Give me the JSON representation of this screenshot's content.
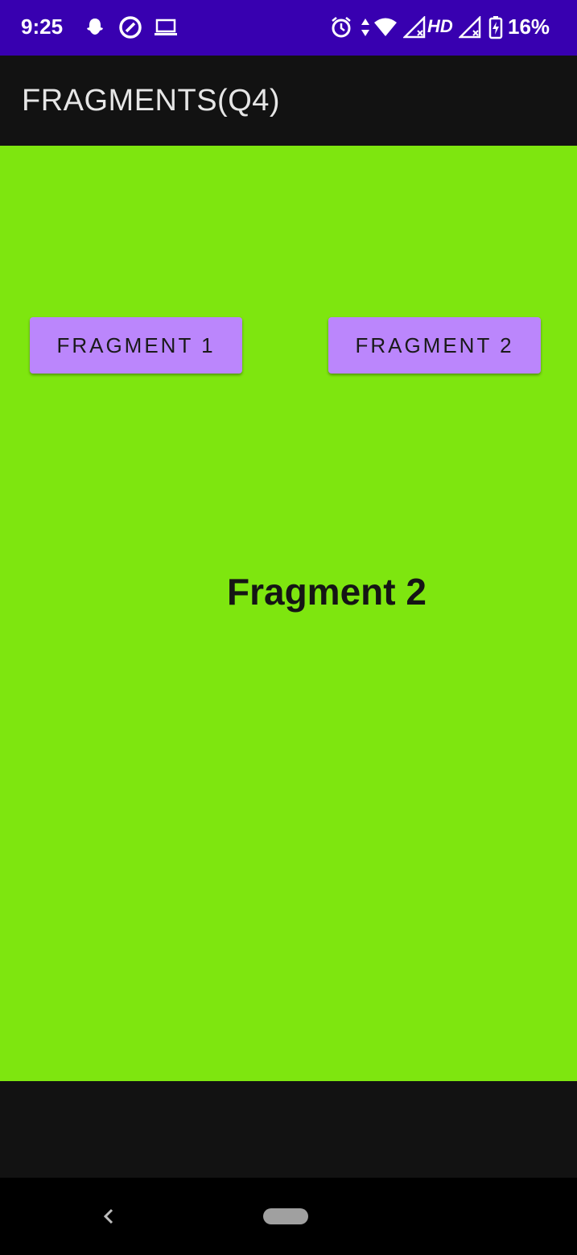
{
  "status_bar": {
    "time": "9:25",
    "network": "HD",
    "battery": "16%",
    "icons": [
      "snapchat-icon",
      "vpn-icon",
      "laptop-icon",
      "alarm-icon",
      "data-arrows-icon",
      "wifi-icon",
      "signal-icon",
      "signal-icon-2",
      "battery-charging-icon"
    ]
  },
  "app_bar": {
    "title": "FRAGMENTS(Q4)"
  },
  "main": {
    "buttons": [
      {
        "label": "FRAGMENT 1"
      },
      {
        "label": "FRAGMENT 2"
      }
    ],
    "fragment_text": "Fragment 2"
  },
  "nav_bar": {
    "icons": [
      "back-icon",
      "home-pill-icon"
    ]
  },
  "colors": {
    "status_bar_bg": "#3800b0",
    "app_bar_bg": "#121212",
    "content_bg": "#7ee60f",
    "button_bg": "#bb86fc"
  }
}
